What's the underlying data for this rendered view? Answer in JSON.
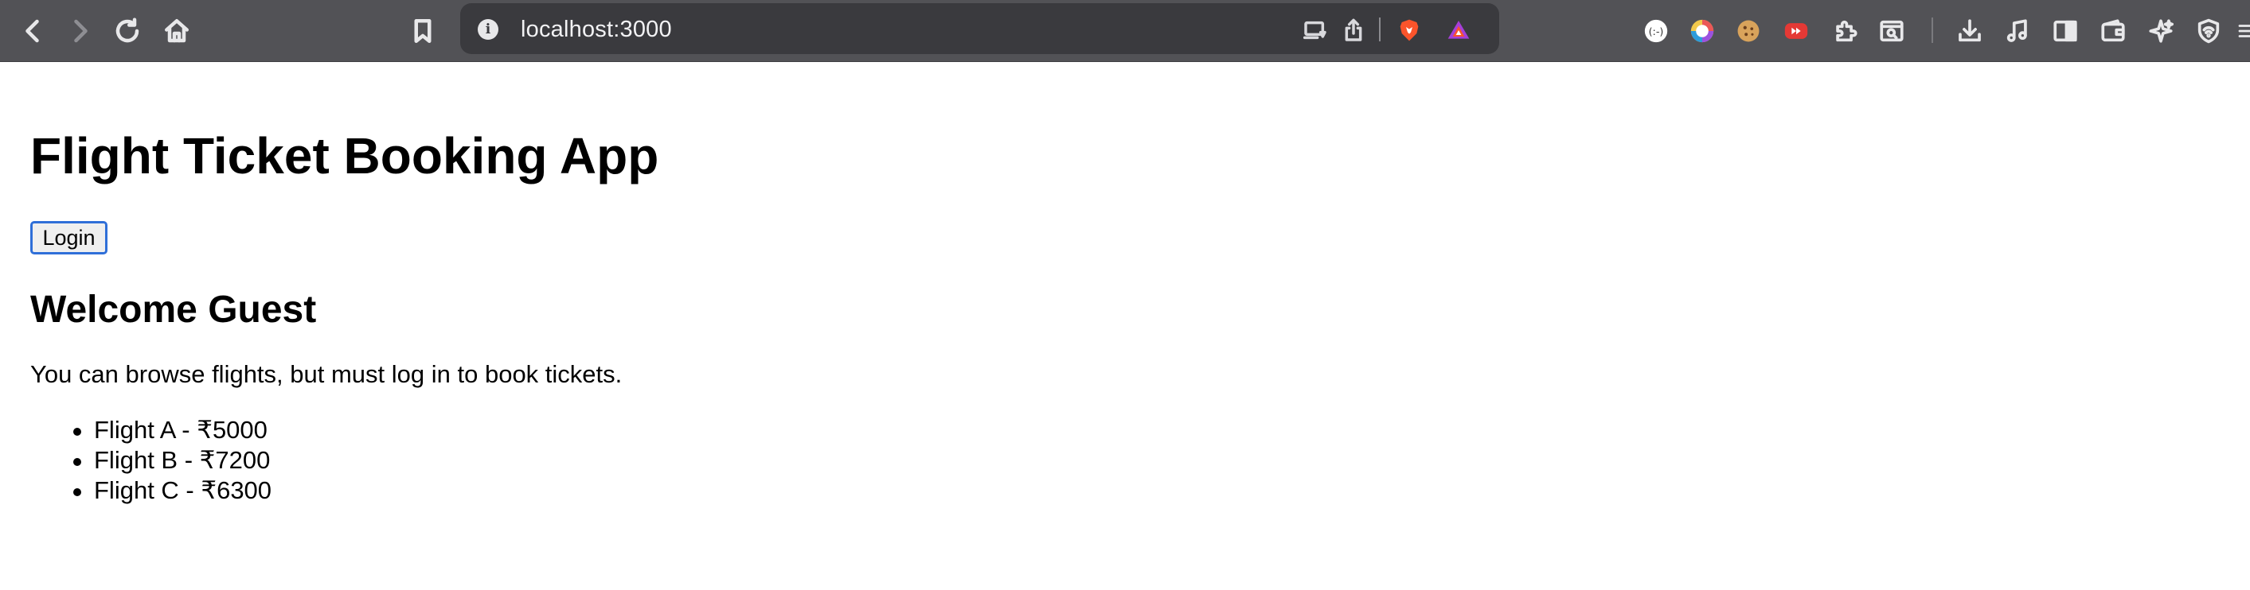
{
  "browser": {
    "url": "localhost:3000",
    "toolbar_icons": [
      "back-icon",
      "forward-icon",
      "reload-icon",
      "home-icon",
      "bookmark-icon"
    ],
    "url_icons": [
      "site-info-icon",
      "cast-icon",
      "share-icon",
      "brave-shields-icon",
      "brave-rewards-icon"
    ],
    "extension_icons": [
      "extension-1-icon",
      "color-wheel-icon",
      "cookie-icon",
      "video-ext-icon",
      "extensions-puzzle-icon",
      "reader-search-icon",
      "downloads-icon",
      "media-icon",
      "sidebar-icon",
      "wallet-icon",
      "leo-ai-icon",
      "vpn-icon",
      "menu-icon"
    ]
  },
  "page": {
    "title": "Flight Ticket Booking App",
    "login_label": "Login",
    "welcome": "Welcome Guest",
    "info": "You can browse flights, but must log in to book tickets.",
    "flights": [
      "Flight A - ₹5000",
      "Flight B - ₹7200",
      "Flight C - ₹6300"
    ]
  },
  "colors": {
    "toolbar_bg": "#525256",
    "urlbar_bg": "#3a3a3e",
    "focus_ring": "#2f6fd8"
  }
}
